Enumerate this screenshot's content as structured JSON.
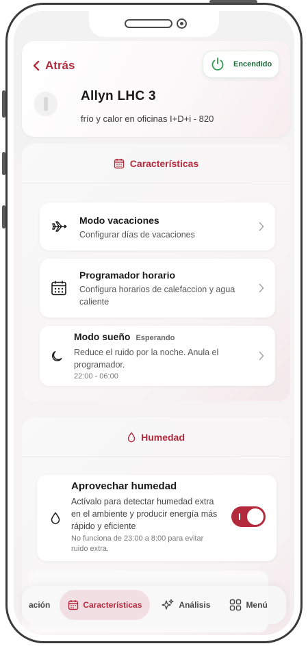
{
  "header": {
    "back_label": "Atrás",
    "power_label": "Encendido",
    "device_name": "Allyn LHC 3",
    "device_sub": "frío y calor en oficinas I+D+i - 820"
  },
  "caracteristicas": {
    "title": "Características",
    "items": [
      {
        "title": "Modo vacaciones",
        "desc": "Configurar días de vacaciones",
        "icon": "airplane-icon"
      },
      {
        "title": "Programador horario",
        "desc": "Configura horarios de calefaccion y agua caliente",
        "icon": "calendar-icon"
      },
      {
        "title": "Modo sueño",
        "badge": "Esperando",
        "desc": "Reduce el ruido por la noche. Anula el programador.",
        "time": "22:00 - 06:00",
        "icon": "moon-icon"
      }
    ]
  },
  "humedad": {
    "title": "Humedad",
    "item": {
      "title": "Aprovechar humedad",
      "desc": "Actívalo para detectar humedad extra en el ambiente y producir energía más rápido y eficiente",
      "note": "No funciona de 23:00 a 8:00 para evitar ruido extra.",
      "toggle_on": true
    }
  },
  "nav": {
    "items": [
      {
        "label": "ación"
      },
      {
        "label": "Características",
        "active": true
      },
      {
        "label": "Análisis"
      },
      {
        "label": "Menú"
      }
    ]
  },
  "colors": {
    "accent": "#b22a3c",
    "power_green": "#1c6b36"
  }
}
